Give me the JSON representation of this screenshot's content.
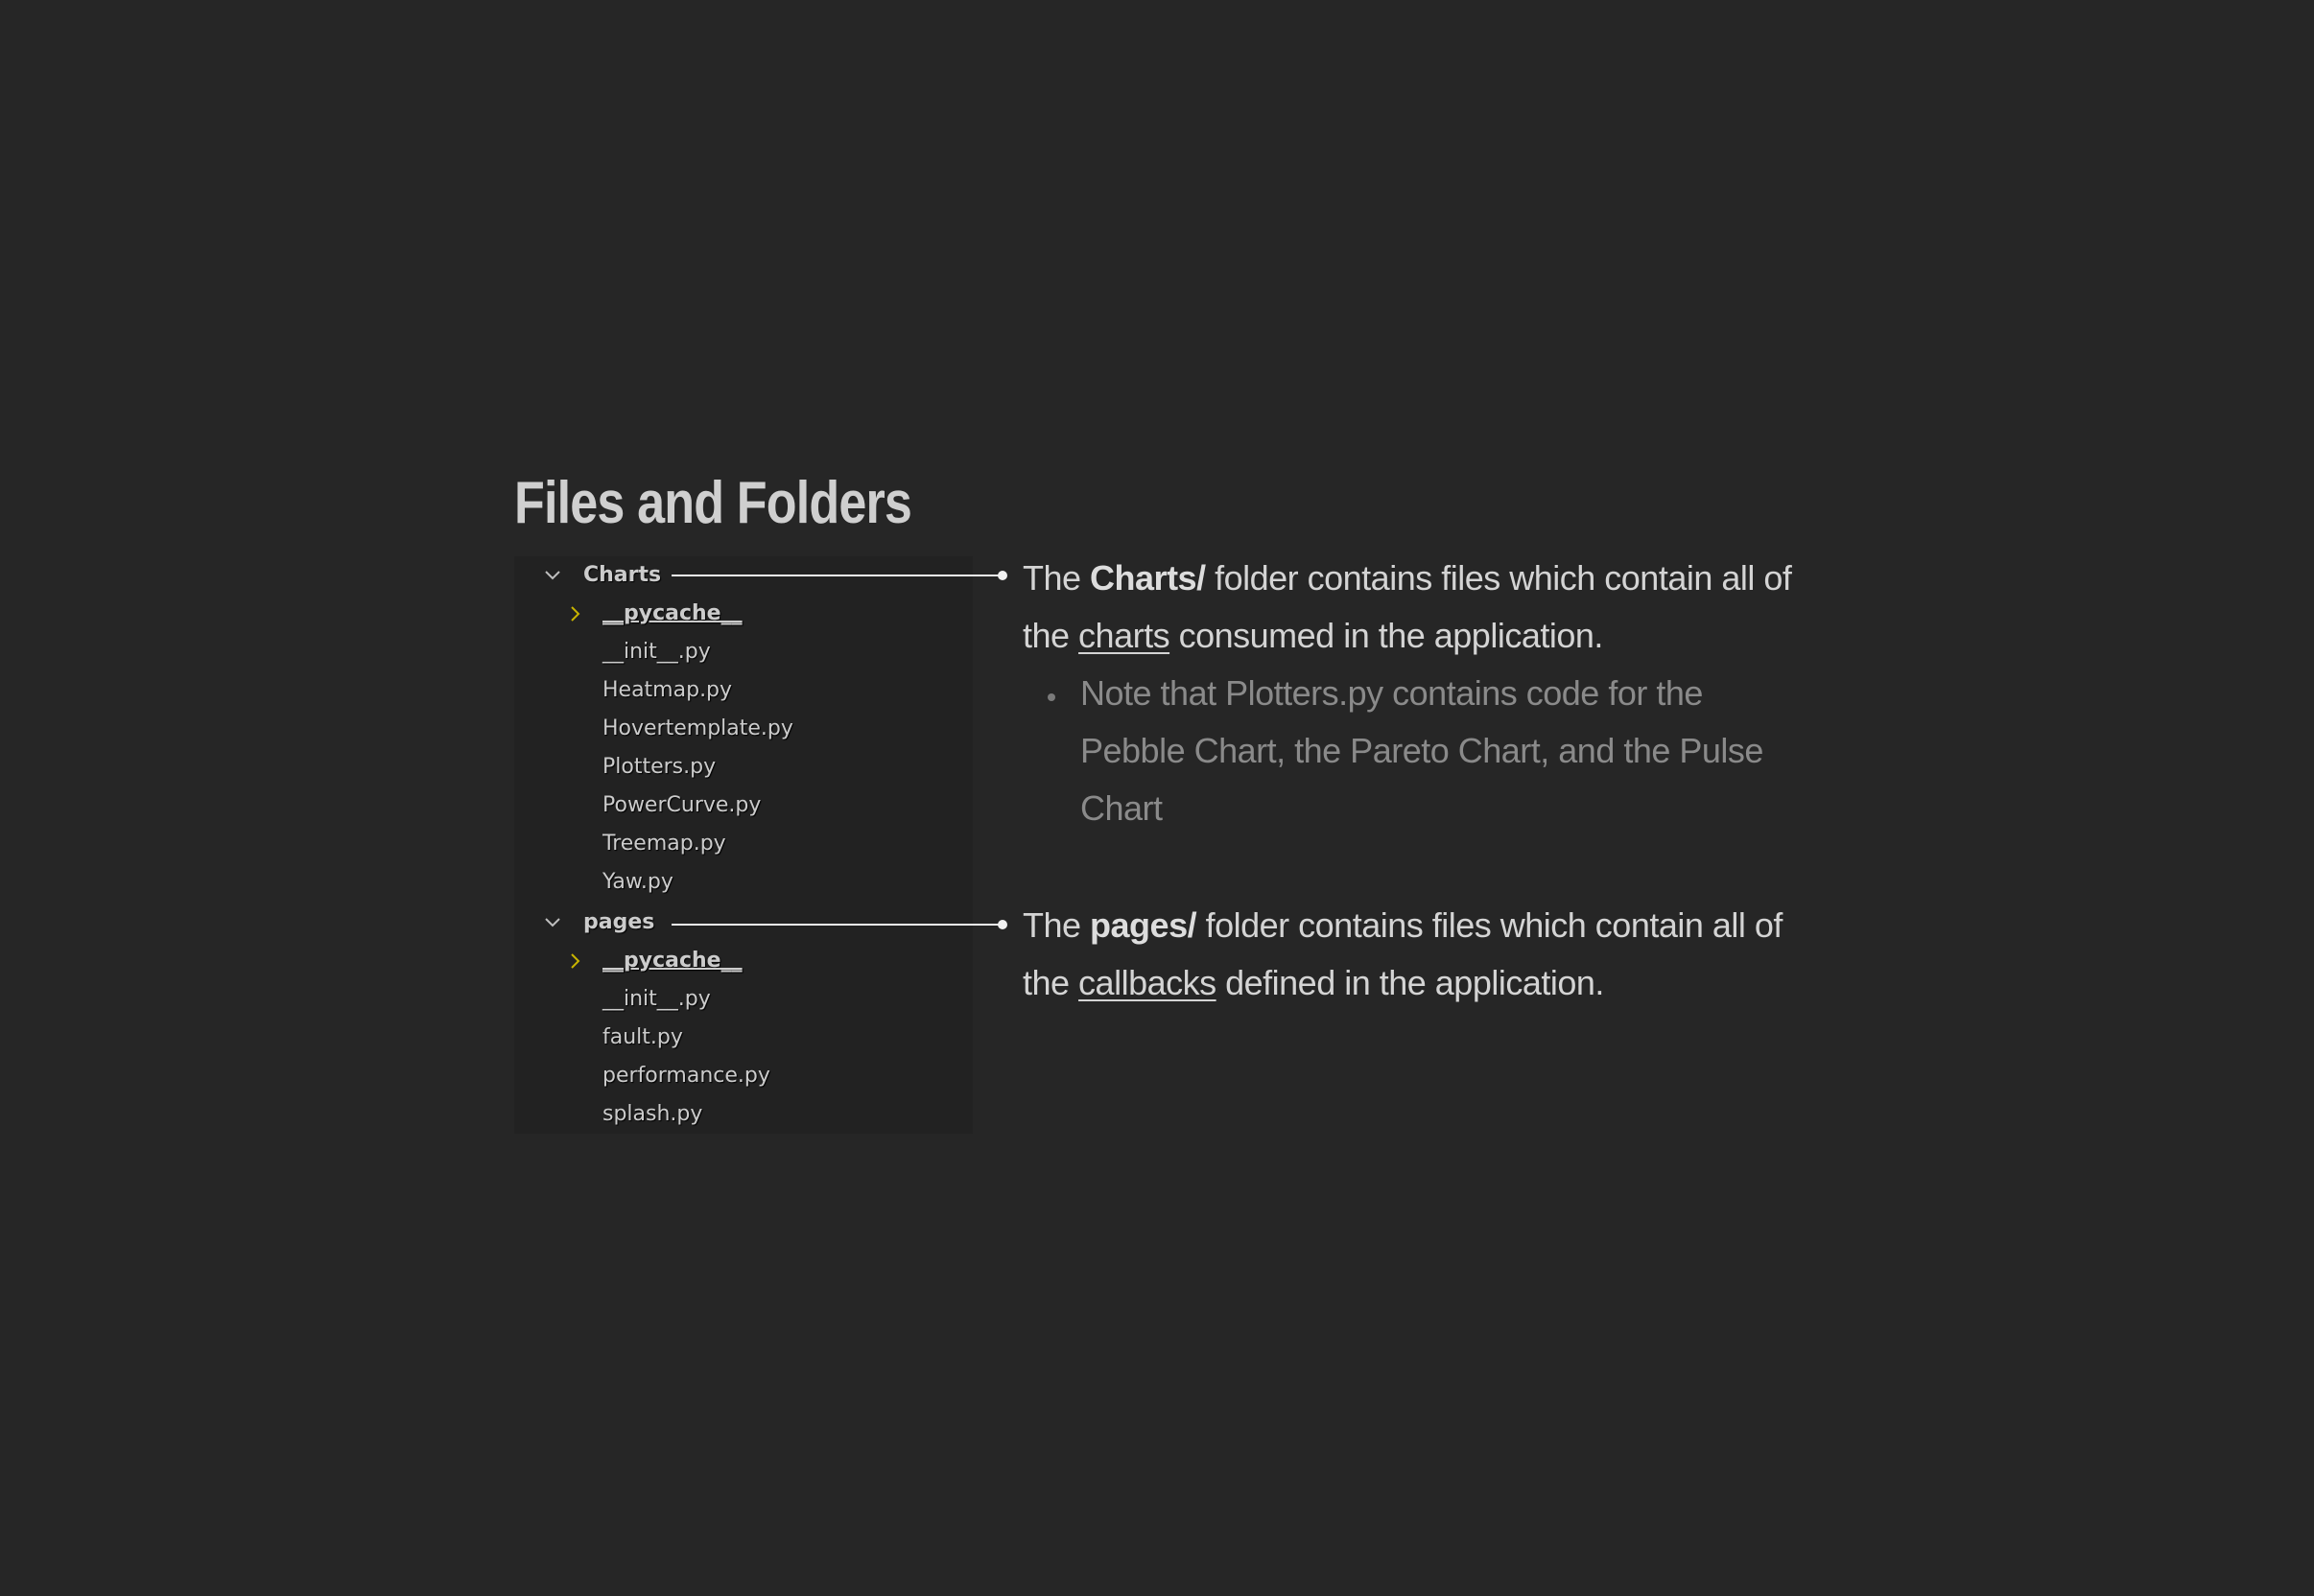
{
  "title": "Files and Folders",
  "tree": [
    {
      "kind": "folder",
      "name": "Charts",
      "expanded": true,
      "icon": "chevron-down-icon"
    },
    {
      "kind": "cache",
      "name": "__pycache__",
      "expanded": false,
      "icon": "chevron-right-icon"
    },
    {
      "kind": "file",
      "name": "__init__.py"
    },
    {
      "kind": "file",
      "name": "Heatmap.py"
    },
    {
      "kind": "file",
      "name": "Hovertemplate.py"
    },
    {
      "kind": "file",
      "name": "Plotters.py"
    },
    {
      "kind": "file",
      "name": "PowerCurve.py"
    },
    {
      "kind": "file",
      "name": "Treemap.py"
    },
    {
      "kind": "file",
      "name": "Yaw.py"
    },
    {
      "kind": "folder",
      "name": "pages",
      "expanded": true,
      "icon": "chevron-down-icon"
    },
    {
      "kind": "cache",
      "name": "__pycache__",
      "expanded": false,
      "icon": "chevron-right-icon"
    },
    {
      "kind": "file",
      "name": "__init__.py"
    },
    {
      "kind": "file",
      "name": "fault.py"
    },
    {
      "kind": "file",
      "name": "performance.py"
    },
    {
      "kind": "file",
      "name": "splash.py"
    }
  ],
  "charts_desc": {
    "prefix": "The ",
    "bold": "Charts/",
    "middle": " folder contains files which contain all of the ",
    "underlined": "charts",
    "suffix": " consumed in the application."
  },
  "charts_note": "Note that Plotters.py contains code for the Pebble Chart, the Pareto Chart, and the Pulse Chart",
  "pages_desc": {
    "prefix": "The ",
    "bold": "pages/",
    "middle": " folder contains files which contain all of the ",
    "underlined": "callbacks",
    "suffix": " defined in the application."
  },
  "colors": {
    "background": "#262626",
    "tree_background": "#222222",
    "cache_chevron": "#c8b400",
    "connector": "#f2f2f2",
    "note_text": "#8a8a8a"
  }
}
